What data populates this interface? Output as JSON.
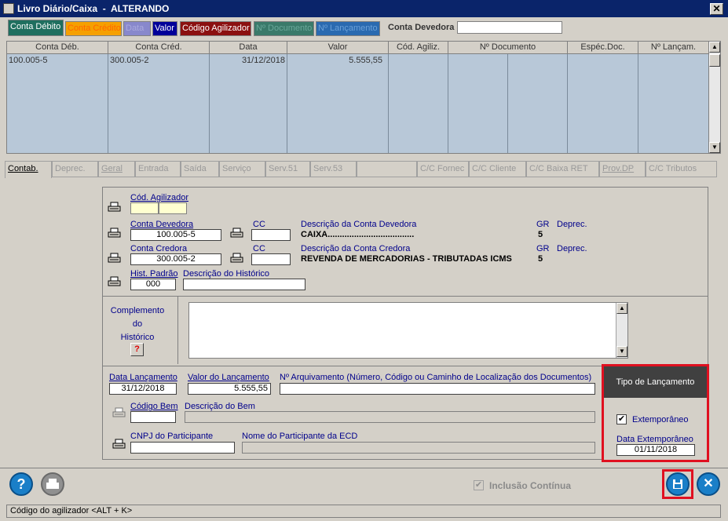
{
  "window": {
    "title": "Livro Diário/Caixa",
    "mode": "ALTERANDO",
    "close_glyph": "✕"
  },
  "top_tabs": [
    {
      "label": "Conta Débito",
      "bg": "#1f6f5f",
      "fg": "#ffffff"
    },
    {
      "label": "Conta Crédito",
      "bg": "#f5a000",
      "fg": "#ff6600"
    },
    {
      "label": "Data",
      "bg": "#8888cc",
      "fg": "#aaaadd"
    },
    {
      "label": "Valor",
      "bg": "#000099",
      "fg": "#ffffff"
    },
    {
      "label": "Código Agilizador",
      "bg": "#8b1010",
      "fg": "#ffffff"
    },
    {
      "label": "Nº Documento",
      "bg": "#3a7a6a",
      "fg": "#6aa89a"
    },
    {
      "label": "Nº Lançamento",
      "bg": "#2a6ab0",
      "fg": "#6aa0d8"
    }
  ],
  "conta_devedora_label": "Conta Devedora",
  "grid": {
    "headers": [
      "Conta Déb.",
      "Conta Créd.",
      "Data",
      "Valor",
      "Cód. Agiliz.",
      "Nº Documento",
      "Espéc.Doc.",
      "Nº Lançam."
    ],
    "rows": [
      {
        "conta_deb": "100.005-5",
        "conta_cred": "300.005-2",
        "data": "31/12/2018",
        "valor": "5.555,55"
      }
    ]
  },
  "sub_tabs": [
    "Contab.",
    "Deprec.",
    "Geral",
    "Entrada",
    "Saída",
    "Serviço",
    "Serv.51",
    "Serv.53",
    "",
    "C/C Fornec",
    "C/C Cliente",
    "C/C Baixa RET",
    "Prov.DP",
    "C/C Tributos"
  ],
  "form": {
    "cod_agilizador_label": "Cód. Agilizador",
    "conta_devedora_label": "Conta Devedora",
    "conta_devedora_value": "100.005-5",
    "cc_label": "CC",
    "desc_devedora_label": "Descrição da Conta Devedora",
    "desc_devedora_value": "CAIXA....................................",
    "gr_label": "GR",
    "gr_devedora": "5",
    "deprec_label": "Deprec.",
    "conta_credora_label": "Conta Credora",
    "conta_credora_value": "300.005-2",
    "desc_credora_label": "Descrição da Conta Credora",
    "desc_credora_value": "REVENDA DE MERCADORIAS - TRIBUTADAS ICMS",
    "gr_credora": "5",
    "hist_padrao_label": "Hist. Padrão",
    "hist_padrao_value": "000",
    "desc_historico_label": "Descrição do Histórico",
    "complemento_l1": "Complemento",
    "complemento_l2": "do",
    "complemento_l3": "Histórico",
    "help_glyph": "?",
    "data_lanc_label": "Data Lançamento",
    "data_lanc_value": "31/12/2018",
    "valor_lanc_label": "Valor do Lançamento",
    "valor_lanc_value": "5.555,55",
    "arquivamento_label": "Nº Arquivamento (Número, Código ou Caminho de Localização dos Documentos)",
    "codigo_bem_label": "Código Bem",
    "descricao_bem_label": "Descrição do Bem",
    "cnpj_label": "CNPJ do Participante",
    "nome_participante_label": "Nome do Participante da ECD"
  },
  "tipo": {
    "title": "Tipo de Lançamento",
    "extemporaneo_label": "Extemporâneo",
    "extemporaneo_checked": "✔",
    "data_extemp_label": "Data Extemporâneo",
    "data_extemp_value": "01/11/2018"
  },
  "bottom": {
    "help_glyph": "?",
    "inclusao_label": "Inclusão Contínua",
    "inclusao_check": "✔",
    "save_glyph": "💾",
    "cancel_glyph": "✕"
  },
  "status_text": "Código do agilizador  <ALT + K>",
  "colors": {
    "accent_red": "#e01020",
    "grid_bg": "#b8c8d8",
    "title_bg": "#0a246a",
    "round_button": "#1a7fc8"
  }
}
